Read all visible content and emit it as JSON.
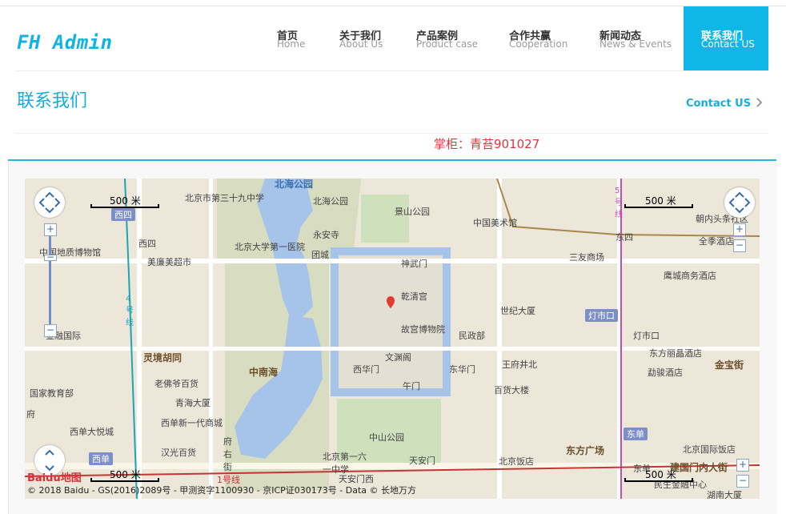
{
  "brand": {
    "logo": "FH Admin",
    "accent": "#11b3e0"
  },
  "nav": [
    {
      "cn": "首页",
      "en": "Home",
      "active": false
    },
    {
      "cn": "关于我们",
      "en": "About Us",
      "active": false
    },
    {
      "cn": "产品案例",
      "en": "Product case",
      "active": false
    },
    {
      "cn": "合作共赢",
      "en": "Cooperation",
      "active": false
    },
    {
      "cn": "新闻动态",
      "en": "News & Events",
      "active": false
    },
    {
      "cn": "联系我们",
      "en": "Contact US",
      "active": true
    }
  ],
  "page": {
    "title": "联系我们",
    "breadcrumb": "Contact US",
    "owner_text": "掌柜：青苔901027"
  },
  "map": {
    "scale_label": "500 米",
    "copyright": "© 2018 Baidu - GS(2016)2089号 - 甲测资字1100930 - 京ICP证030173号 - Data © 长地万方",
    "logo_text": "Baidu地图",
    "labels": {
      "beihai": "北海公园",
      "beihai_park": "北海公园",
      "jingshan": "景山公园",
      "school39": "北京市第三十九中学",
      "xisi_tag": "西四",
      "xisi": "西四",
      "geo_museum": "中国地质博物馆",
      "meilian": "美廉美超市",
      "pku_hospital": "北京大学第一医院",
      "yongan": "永安寺",
      "tuancheng": "团城",
      "shenwu": "神武门",
      "qianqing": "乾清宫",
      "palace_museum": "故宫博物院",
      "art_museum": "中国美术馆",
      "dongsi": "东四",
      "chaonei": "朝内头条社区",
      "quanjiye": "全季酒店",
      "sanlian": "三友商场",
      "yingcheng": "鹰城商务酒店",
      "shiji": "世纪大厦",
      "dengshikou_tag": "灯市口",
      "dengshikou": "灯市口",
      "minzheng": "民政部",
      "wangfujing": "王府井北",
      "lijing": "东方丽晶酒店",
      "mianyan": "勐骏酒店",
      "jinbaojie": "金宝街",
      "zhongnanhai": "中南海",
      "lingjing": "灵境胡同",
      "wenyuan": "文渊阁",
      "xihuamen": "西华门",
      "donghuamen": "东华门",
      "wumen": "午门",
      "baihuo": "百货大楼",
      "laodian": "老佛爷百货",
      "qinghai": "青海大厦",
      "xidan_new": "西单新一代商城",
      "jiaoyu": "国家教育部",
      "xidan_big": "西单大悦城",
      "hanguang": "汉光百货",
      "xidan_tag": "西单",
      "dongdan_tag": "东单",
      "dongfang": "东方广场",
      "intl_hotel": "北京国际饭店",
      "zhongshan": "中山公园",
      "tiananmen": "天安门",
      "tiananmen_w": "天安门西",
      "beijing_hotel": "北京饭店",
      "dongdan": "东单",
      "jianguo": "建国门内大街",
      "school61": "北京第一六一中学",
      "fuyou": "府右街",
      "xuanhe": "金融国际",
      "hunan": "湖南大厦",
      "fuxing_line": "1号线",
      "line4": "4号线",
      "line5": "5号线",
      "minsheng": "民生金融中心",
      "fuwu": "府"
    }
  }
}
